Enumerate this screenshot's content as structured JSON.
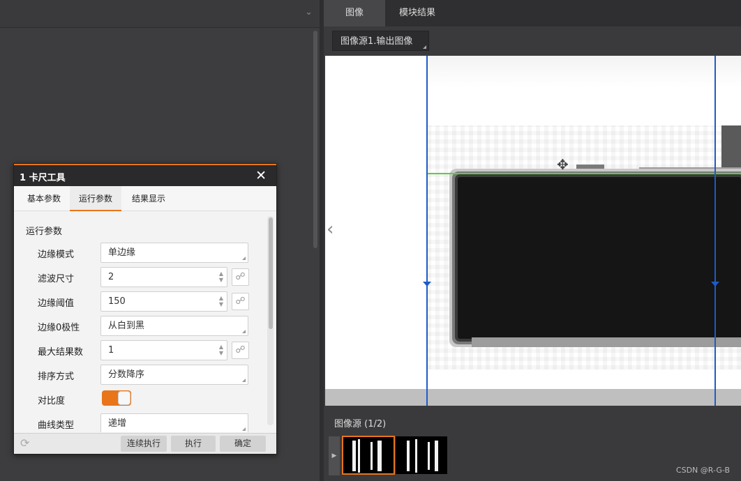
{
  "right_panel": {
    "tabs": [
      {
        "label": "图像"
      },
      {
        "label": "模块结果"
      }
    ],
    "image_source_select": "图像源1.输出图像",
    "image_source_label": "图像源 (1/2)",
    "watermark": "CSDN @R-G-B"
  },
  "dialog": {
    "title": "1 卡尺工具",
    "tabs": [
      {
        "label": "基本参数"
      },
      {
        "label": "运行参数"
      },
      {
        "label": "结果显示"
      }
    ],
    "active_tab": "运行参数",
    "section_title": "运行参数",
    "params": [
      {
        "label": "边缘模式",
        "value": "单边缘"
      },
      {
        "label": "滤波尺寸",
        "value": "2"
      },
      {
        "label": "边缘阈值",
        "value": "150"
      },
      {
        "label": "边缘0极性",
        "value": "从白到黑"
      },
      {
        "label": "最大结果数",
        "value": "1"
      },
      {
        "label": "排序方式",
        "value": "分数降序"
      },
      {
        "label": "对比度",
        "value": "on"
      },
      {
        "label": "曲线类型",
        "value": "递增"
      }
    ],
    "footer": {
      "continuous_run": "连续执行",
      "run": "执行",
      "confirm": "确定"
    }
  },
  "colors": {
    "accent": "#e8751a",
    "caliper_line": "#1e5bc8",
    "edge_line": "#5bd03a"
  },
  "icons": {
    "close": "close-icon",
    "link": "link-icon",
    "refresh": "refresh-icon",
    "move": "move-icon",
    "prev": "chevron-left-icon",
    "expand": "chevron-down-icon"
  }
}
